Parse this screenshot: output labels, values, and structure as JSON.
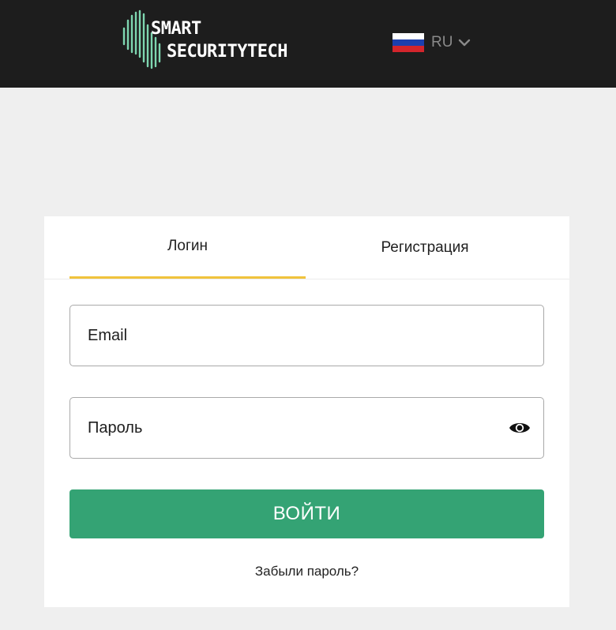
{
  "header": {
    "logo": {
      "line1": "SMART",
      "line2": "SECURITYTECH",
      "mark_color": "#7ed6b0"
    },
    "language": {
      "label": "RU",
      "flag_colors": [
        "#ffffff",
        "#1c3fae",
        "#d3252c"
      ]
    }
  },
  "auth": {
    "tabs": [
      {
        "label": "Логин",
        "active": true
      },
      {
        "label": "Регистрация",
        "active": false
      }
    ],
    "email": {
      "placeholder": "Email",
      "value": ""
    },
    "password": {
      "placeholder": "Пароль",
      "value": ""
    },
    "submit_label": "ВОЙТИ",
    "forgot_label": "Забыли пароль?"
  },
  "colors": {
    "header_bg": "#1d1d1d",
    "accent_tab": "#f0c33c",
    "button": "#34a374",
    "page_bg": "#efefef"
  }
}
